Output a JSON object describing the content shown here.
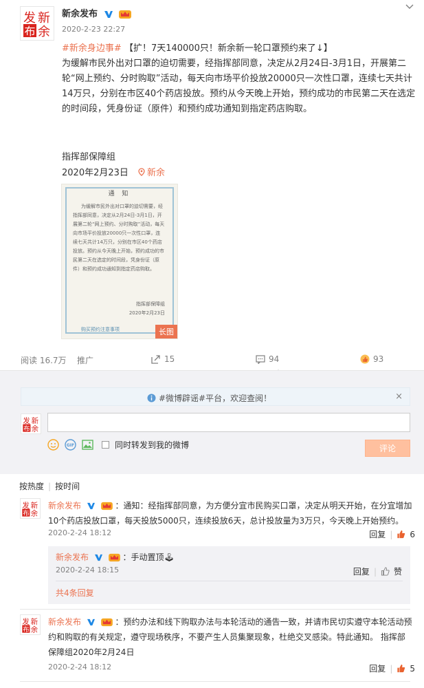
{
  "post": {
    "author": "新余发布",
    "time": "2020-2-23 22:27",
    "topic": "#新余身边事#",
    "headline": "【扩！7天140000只！新余新一轮口罩预约来了↓】",
    "body": "为缓解市民外出对口罩的迫切需要，经指挥部同意，决定从2月24日-3月1日，开展第二轮“网上预约、分时购取”活动，每天向市场平价投放20000只一次性口罩，连续七天共计14万只，分别在市区40个药店投放。预约从今天晚上开始，预约成功的市民第二天在选定的时间段，凭身份证（原件）和预约成功通知到指定药店购取。",
    "signature": "指挥部保障组",
    "date": "2020年2月23日",
    "location": "新余"
  },
  "notice_image": {
    "title": "通 知",
    "text": "为缓解市民外出对口罩的迫切需要，经指挥部同意，决定从2月24日-3月1日，开展第二轮“网上预约、分时购取”活动，每天向市场平价投放20000只一次性口罩，连续七天共计14万只，分别在市区40个药店投放。预约从今天晚上开始，预约成功的市民第二天在选定的时间段，凭身份证（原件）和预约成功通知到指定药店购取。",
    "sign": "指挥部保障组",
    "date": "2020年2月23日",
    "footer": "购买预约注意事项",
    "long_tag": "长图"
  },
  "actions": {
    "reads": "阅读 16.7万",
    "promote": "推广",
    "reposts": "15",
    "comments": "94",
    "likes": "93"
  },
  "banner": {
    "text": "#微博辟谣#平台，欢迎查阅！",
    "close": "×"
  },
  "composer": {
    "placeholder": "",
    "also_post": "同时转发到我的微博",
    "submit": "评论"
  },
  "sort": {
    "hot": "按热度",
    "time": "按时间"
  },
  "comments": [
    {
      "name": "新余发布",
      "text": "：通知：经指挥部同意，为方便分宜市民购买口罩，决定从明天开始，在分宜增加10个药店投放口罩，每天投放5000只，连续投放6天，总计投放量为3万只，今天晚上开始预约。",
      "time": "2020-2-24 18:12",
      "reply": "回复",
      "likes": "6",
      "sub": {
        "name": "新余发布",
        "text": "：手动置顶🕹",
        "time": "2020-2-24 18:15",
        "reply": "回复",
        "like": "赞",
        "more": "共4条回复"
      }
    },
    {
      "name": "新余发布",
      "text": "：预约办法和线下购取办法与本轮活动的通告一致，并请市民切实遵守本轮活动预约和购取的有关规定，遵守现场秩序，不要产生人员集聚现象，杜绝交叉感染。特此通知。 指挥部保障组2020年2月24日",
      "time": "2020-2-24 18:12",
      "reply": "回复",
      "likes": "5"
    }
  ],
  "colors": {
    "accent": "#eb7350",
    "verified": "#1e88e5",
    "submit": "#ffc09f"
  }
}
